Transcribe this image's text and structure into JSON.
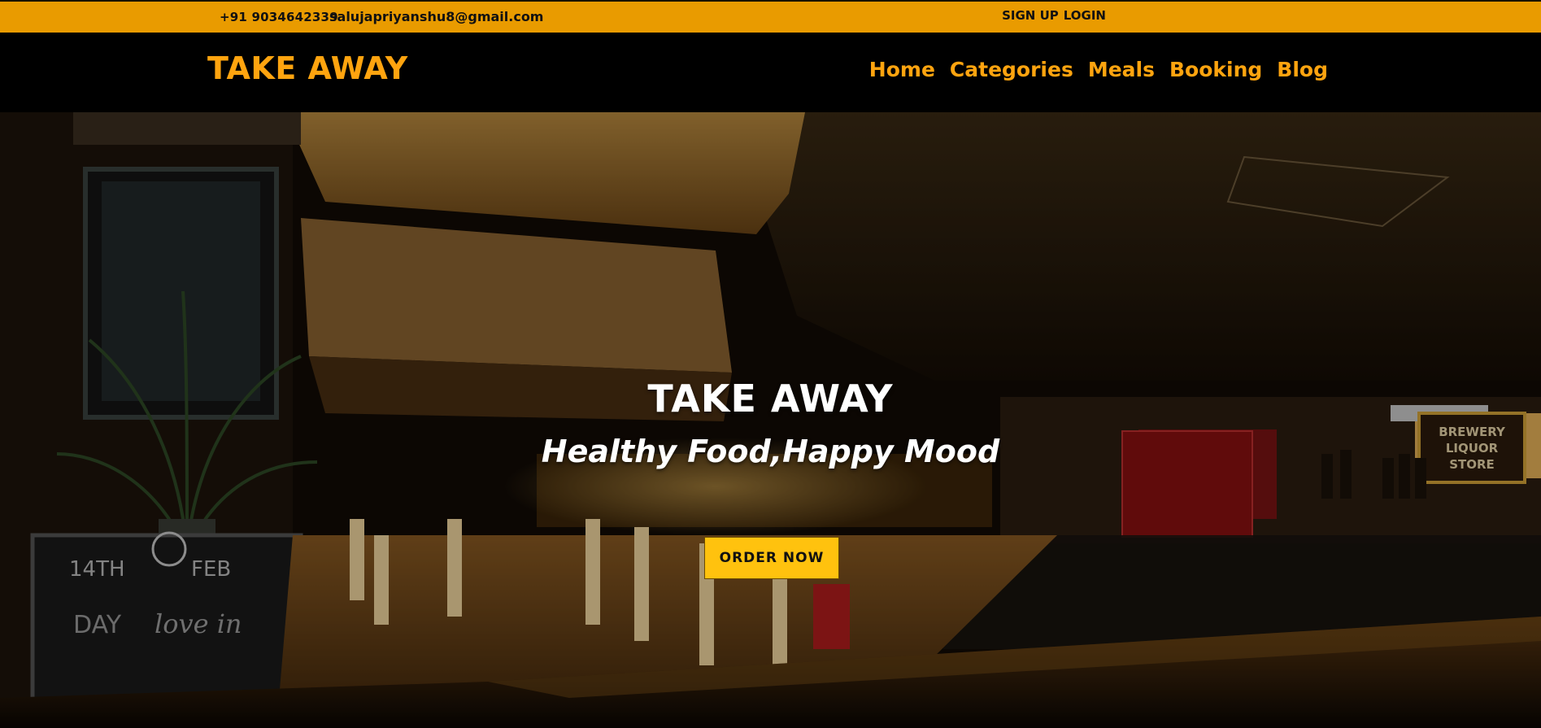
{
  "topbar": {
    "phone": "+91 9034642339",
    "email": "salujapriyanshu8@gmail.com",
    "signup_label": "SIGN UP",
    "login_label": "LOGIN"
  },
  "header": {
    "logo": "TAKE AWAY",
    "nav": [
      {
        "label": "Home"
      },
      {
        "label": "Categories"
      },
      {
        "label": "Meals"
      },
      {
        "label": "Booking"
      },
      {
        "label": "Blog"
      }
    ]
  },
  "hero": {
    "title": "TAKE AWAY",
    "subtitle": "Healthy Food,Happy Mood",
    "cta_label": "ORDER NOW"
  },
  "colors": {
    "topbar_bg": "#e99b00",
    "accent_orange": "#ffa40f",
    "cta_yellow": "#ffc20e",
    "header_bg": "#000000"
  }
}
